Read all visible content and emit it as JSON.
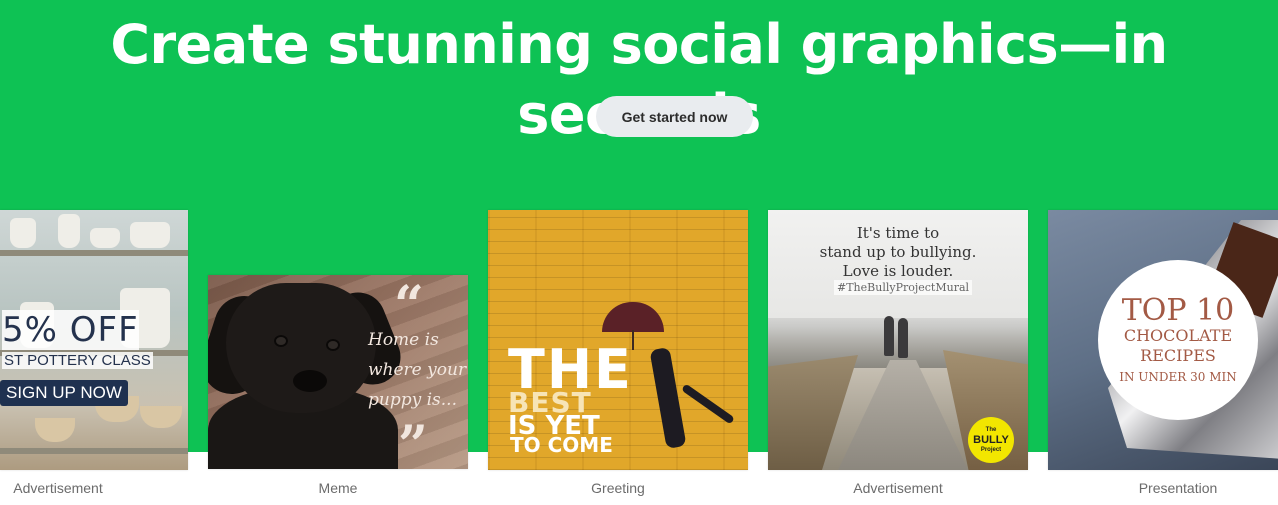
{
  "hero": {
    "headline": "Create stunning social graphics—in seconds",
    "cta_label": "Get started now",
    "background": "#0ec254"
  },
  "cards": [
    {
      "caption": "Advertisement",
      "offer": "5% OFF",
      "subline": "ST POTTERY CLASS",
      "button": "SIGN UP NOW"
    },
    {
      "caption": "Meme",
      "open_quote": "“",
      "text": "Home is where your puppy is...",
      "close_quote": "”"
    },
    {
      "caption": "Greeting",
      "line1": "THE",
      "line2": "BEST",
      "line3": "IS YET",
      "line4": "TO COME"
    },
    {
      "caption": "Advertisement",
      "line1": "It's time to",
      "line2": "stand up to bullying.",
      "line3": "Love is louder.",
      "hashtag": "#TheBullyProjectMural",
      "logo_top": "The",
      "logo_main": "BULLY",
      "logo_bottom": "Project"
    },
    {
      "caption": "Presentation",
      "top": "TOP 10",
      "line1": "CHOCOLATE",
      "line2": "RECIPES",
      "line3": "IN UNDER 30 MIN"
    }
  ]
}
